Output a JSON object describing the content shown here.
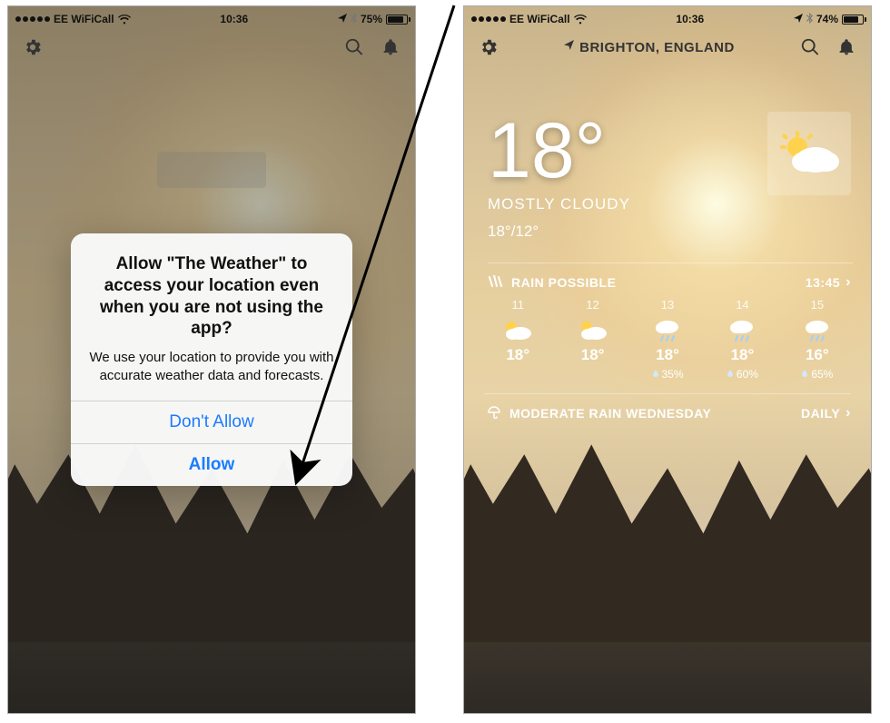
{
  "status": {
    "carrier": "EE WiFiCall",
    "time": "10:36",
    "battery_left": "75%",
    "battery_right": "74%",
    "battery_left_fill": "75%",
    "battery_right_fill": "74%"
  },
  "left": {
    "alert": {
      "title": "Allow \"The Weather\" to access your location even when you are not using the app?",
      "message": "We use your location to provide you with accurate weather data and forecasts.",
      "deny": "Don't Allow",
      "allow": "Allow"
    }
  },
  "right": {
    "location": "BRIGHTON, ENGLAND",
    "temp": "18°",
    "condition": "MOSTLY CLOUDY",
    "hilo": "18°/12°",
    "rain_header": {
      "label": "RAIN POSSIBLE",
      "time": "13:45"
    },
    "hourly": [
      {
        "hour": "11",
        "icon": "partly",
        "temp": "18°",
        "precip": ""
      },
      {
        "hour": "12",
        "icon": "partly",
        "temp": "18°",
        "precip": ""
      },
      {
        "hour": "13",
        "icon": "rain",
        "temp": "18°",
        "precip": "35%"
      },
      {
        "hour": "14",
        "icon": "rain",
        "temp": "18°",
        "precip": "60%"
      },
      {
        "hour": "15",
        "icon": "rain",
        "temp": "16°",
        "precip": "65%"
      }
    ],
    "daily_header": {
      "label": "MODERATE RAIN WEDNESDAY",
      "link": "DAILY"
    }
  }
}
